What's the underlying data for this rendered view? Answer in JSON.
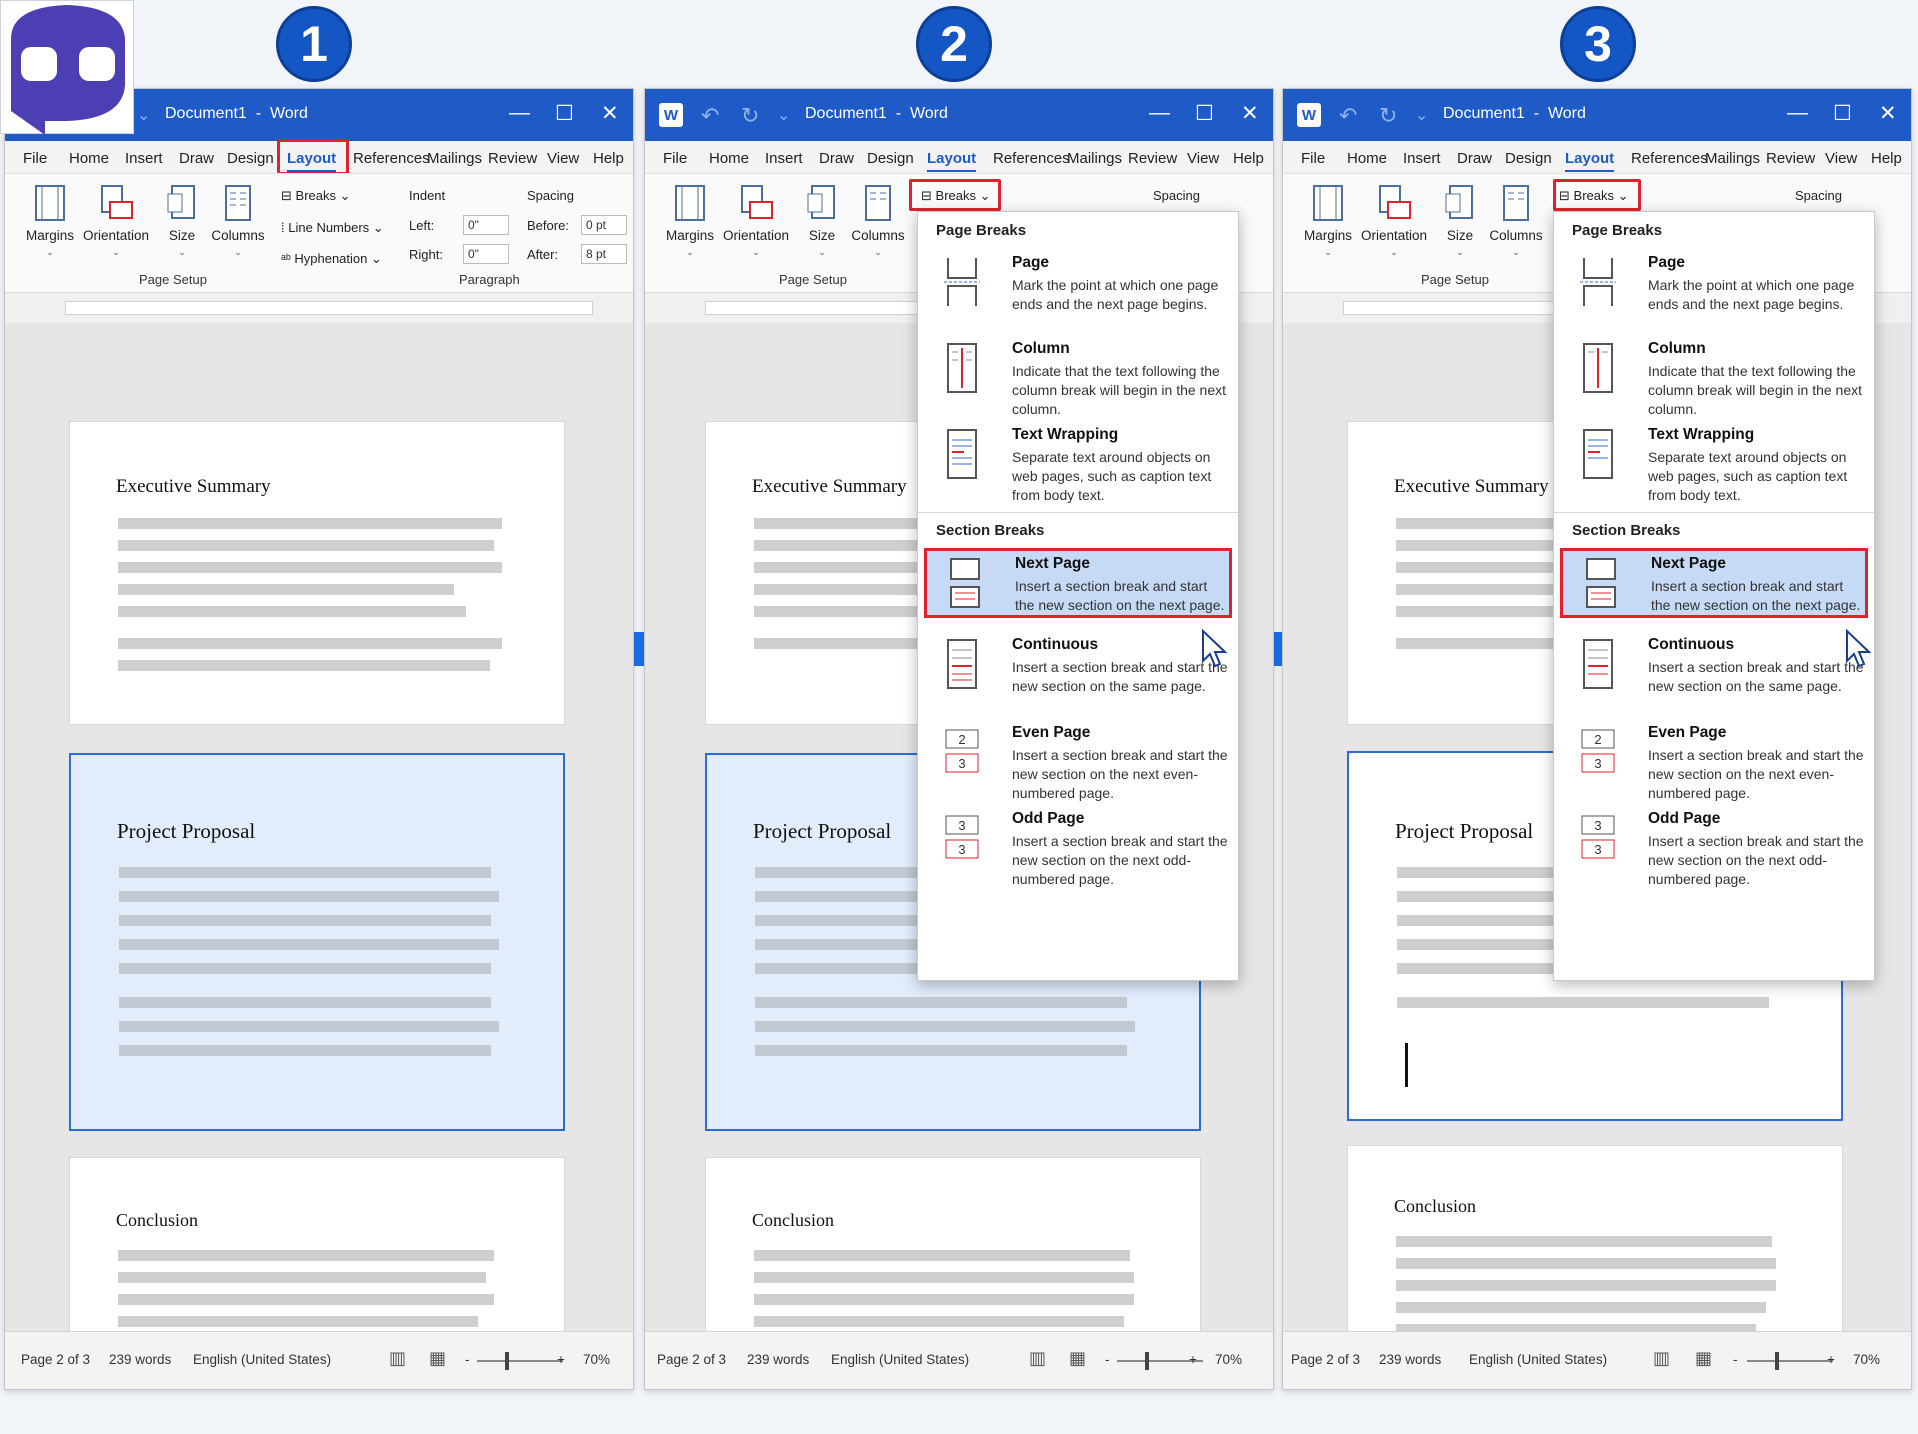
{
  "steps": [
    "1",
    "2",
    "3"
  ],
  "window": {
    "doc_name": "Document1",
    "sep": "-",
    "app": "Word",
    "minimize": "—",
    "maximize": "☐",
    "close": "✕"
  },
  "tabs": [
    "File",
    "Home",
    "Insert",
    "Draw",
    "Design",
    "Layout",
    "References",
    "Mailings",
    "Review",
    "View",
    "Help"
  ],
  "ribbon": {
    "margins": "Margins",
    "orientation": "Orientation",
    "size": "Size",
    "columns": "Columns",
    "breaks": "Breaks",
    "line_numbers": "Line Numbers",
    "hyphenation": "Hyphenation",
    "indent": "Indent",
    "spacing": "Spacing",
    "left": "Left:",
    "right": "Right:",
    "before": "Before:",
    "after": "After:",
    "left_val": "0\"",
    "right_val": "0\"",
    "before_val": "0 pt",
    "after_val": "8 pt",
    "page_setup": "Page Setup",
    "paragraph": "Paragraph"
  },
  "document": {
    "sections": [
      "Executive Summary",
      "Project Proposal",
      "Conclusion"
    ]
  },
  "dropdown": {
    "page_breaks": "Page Breaks",
    "section_breaks": "Section Breaks",
    "items": [
      {
        "title": "Page",
        "desc": "Mark the point at which one page ends and the next page begins."
      },
      {
        "title": "Column",
        "desc": "Indicate that the text following the column break will begin in the next column."
      },
      {
        "title": "Text Wrapping",
        "desc": "Separate text around objects on web pages, such as caption text from body text."
      },
      {
        "title": "Next Page",
        "desc": "Insert a section break and start the new section on the next page."
      },
      {
        "title": "Continuous",
        "desc": "Insert a section break and start the new section on the same page."
      },
      {
        "title": "Even Page",
        "desc": "Insert a section break and start the new section on the next even-numbered page."
      },
      {
        "title": "Odd Page",
        "desc": "Insert a section break and start the new section on the next odd-numbered page."
      }
    ]
  },
  "status": {
    "page": "Page 2 of 3",
    "words": "239 words",
    "language": "English (United States)",
    "zoom_minus": "-",
    "zoom_plus": "+",
    "zoom": "70%"
  },
  "colors": {
    "title_bar": "#1e5bc6",
    "step_badge": "#1456c4",
    "arrow": "#1a6fe8",
    "highlight_box": "#e0222b",
    "selection": "#e2ecfb"
  }
}
